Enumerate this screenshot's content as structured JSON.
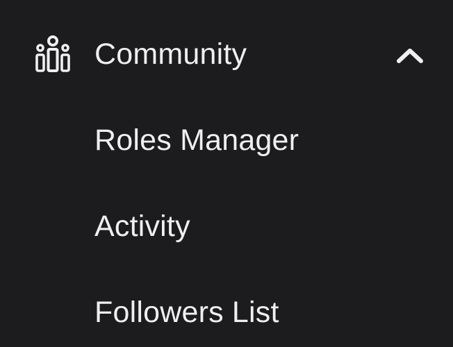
{
  "nav": {
    "section": {
      "title": "Community",
      "icon": "community-icon",
      "expanded": true,
      "chevron_icon": "chevron-up-icon"
    },
    "items": [
      {
        "label": "Roles Manager"
      },
      {
        "label": "Activity"
      },
      {
        "label": "Followers List"
      }
    ]
  },
  "colors": {
    "background": "#1c1b1d",
    "text": "#efeff1"
  }
}
